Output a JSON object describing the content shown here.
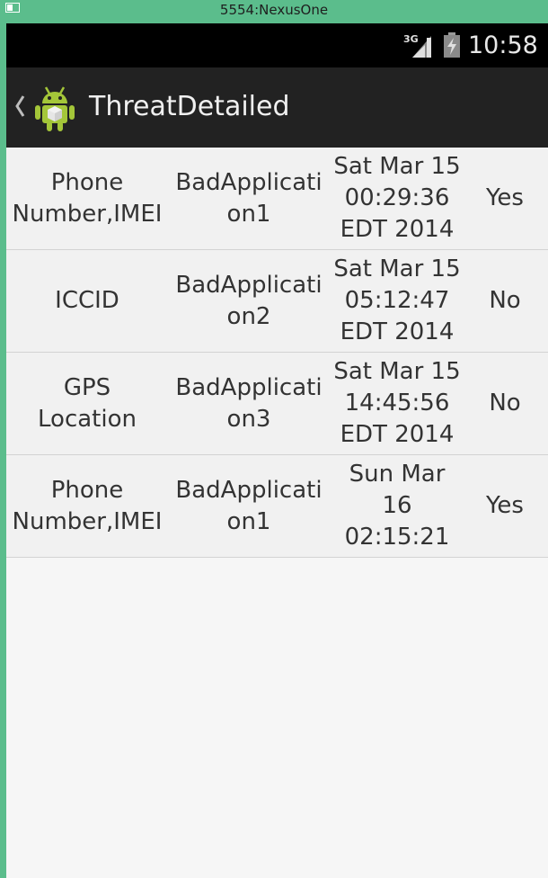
{
  "window": {
    "title": "5554:NexusOne"
  },
  "status_bar": {
    "network": "3G",
    "time": "10:58"
  },
  "action_bar": {
    "title": "ThreatDetailed"
  },
  "rows": [
    {
      "data_type": "Phone Number,IMEI",
      "app": "BadApplication1",
      "date": "Sat Mar 15 00:29:36 EDT 2014",
      "status": "Yes"
    },
    {
      "data_type": "ICCID",
      "app": "BadApplication2",
      "date": "Sat Mar 15 05:12:47 EDT 2014",
      "status": "No"
    },
    {
      "data_type": "GPS Location",
      "app": "BadApplication3",
      "date": "Sat Mar 15 14:45:56 EDT 2014",
      "status": "No"
    },
    {
      "data_type": "Phone Number,IMEI",
      "app": "BadApplication1",
      "date": "Sun Mar 16 02:15:21",
      "status": "Yes"
    }
  ],
  "colors": {
    "window_frame": "#5bbd8c",
    "status_bar": "#000000",
    "action_bar": "#222222",
    "list_background": "#f1f1f1",
    "text": "#333333"
  }
}
